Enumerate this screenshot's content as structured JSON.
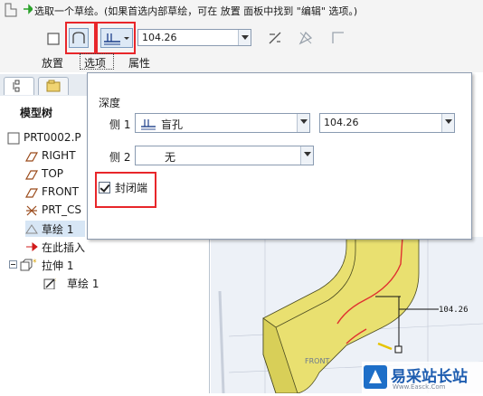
{
  "dashboard": {
    "hint": "选取一个草绘。(如果首选内部草绘，可在 放置 面板中找到 \"编辑\" 选项。)",
    "depth_value": "104.26",
    "tabs": [
      "放置",
      "选项",
      "属性"
    ]
  },
  "tree": {
    "title": "模型树",
    "items": [
      {
        "label": "PRT0002.P",
        "icon": "part-icon"
      },
      {
        "label": "RIGHT",
        "icon": "datum-plane-icon"
      },
      {
        "label": "TOP",
        "icon": "datum-plane-icon"
      },
      {
        "label": "FRONT",
        "icon": "datum-plane-icon"
      },
      {
        "label": "PRT_CS",
        "icon": "coordinate-system-icon"
      },
      {
        "label": "草绘 1",
        "icon": "sketch-icon"
      },
      {
        "label": "在此插入",
        "icon": "insert-arrow-icon"
      },
      {
        "label": "拉伸 1",
        "icon": "extrude-icon"
      },
      {
        "label": "草绘 1",
        "icon": "sketch-icon"
      }
    ]
  },
  "options_panel": {
    "section_title": "深度",
    "side1": {
      "label": "侧 1",
      "type": "盲孔",
      "value": "104.26"
    },
    "side2": {
      "label": "侧 2",
      "type": "无"
    },
    "capped_ends": {
      "label": "封闭端",
      "checked": true
    }
  },
  "viewport": {
    "dimension_label": "104.26",
    "plane_label": "FRONT"
  },
  "watermark": {
    "text": "易采站长站",
    "sub": "Www.Easck.Com"
  },
  "colors": {
    "highlight_box": "#e8262a",
    "model_yellow": "#e9e070",
    "selection": "#d7e6f5"
  }
}
